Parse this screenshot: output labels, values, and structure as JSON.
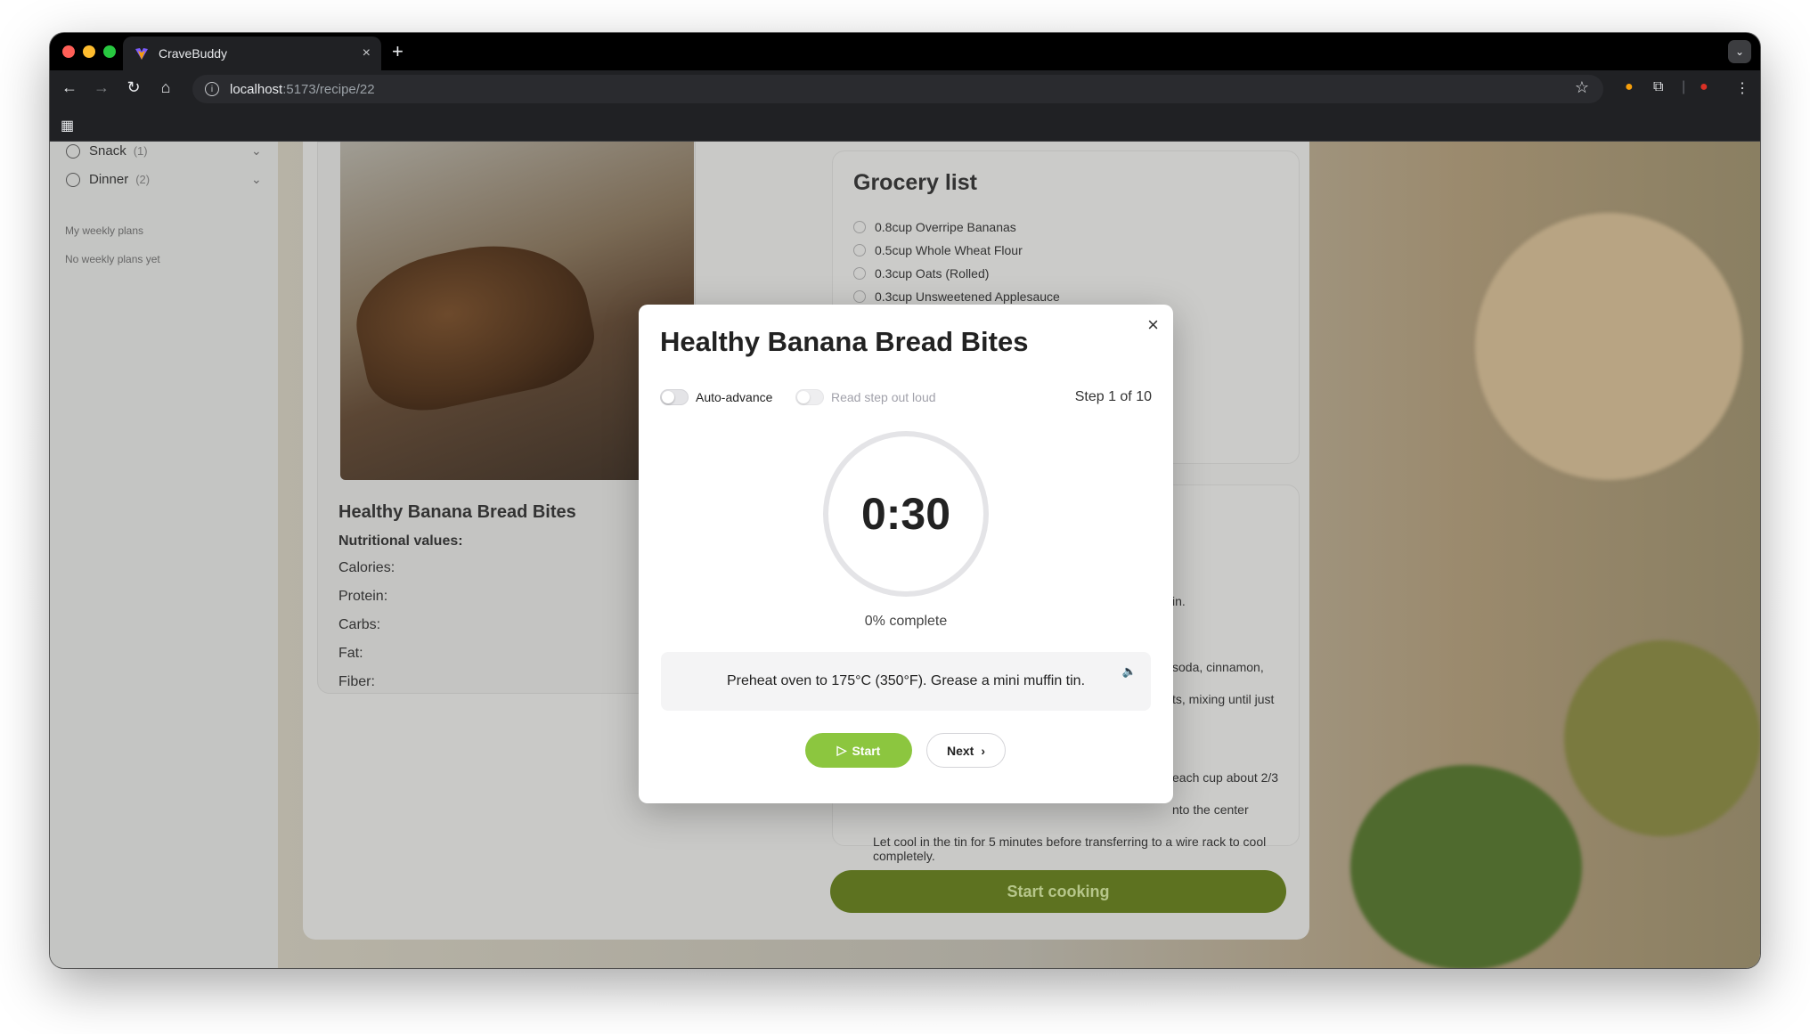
{
  "browser": {
    "tab_title": "CraveBuddy",
    "url_host": "localhost",
    "url_path": ":5173/recipe/22",
    "new_tab": "+",
    "tab_close": "×"
  },
  "sidebar": {
    "items": [
      {
        "label": "Snack",
        "count": "(1)"
      },
      {
        "label": "Dinner",
        "count": "(2)"
      }
    ],
    "weekly_title": "My weekly plans",
    "weekly_empty": "No weekly plans yet"
  },
  "recipe": {
    "title": "Healthy Banana Bread Bites",
    "nutrition_heading": "Nutritional values:",
    "nutrition": [
      "Calories:",
      "Protein:",
      "Carbs:",
      "Fat:",
      "Fiber:"
    ]
  },
  "grocery": {
    "title": "Grocery list",
    "items": [
      "0.8cup Overripe Bananas",
      "0.5cup Whole Wheat Flour",
      "0.3cup Oats (Rolled)",
      "0.3cup Unsweetened Applesauce"
    ]
  },
  "steps_fragments": {
    "f1": "in.",
    "f2": "soda, cinnamon,",
    "f3": "ts, mixing until just",
    "f4": "each cup about 2/3",
    "f5": "nto the center",
    "f6": "Let cool in the tin for 5 minutes before transferring to a wire rack to cool",
    "f7": "completely."
  },
  "start_cooking": "Start cooking",
  "modal": {
    "title": "Healthy Banana Bread Bites",
    "auto_advance": "Auto-advance",
    "read_aloud": "Read step out loud",
    "step_label": "Step 1 of 10",
    "timer": "0:30",
    "progress": "0% complete",
    "progress_value": 0,
    "step_text": "Preheat oven to 175°C (350°F). Grease a mini muffin tin.",
    "start_label": "Start",
    "next_label": "Next",
    "close": "×"
  }
}
